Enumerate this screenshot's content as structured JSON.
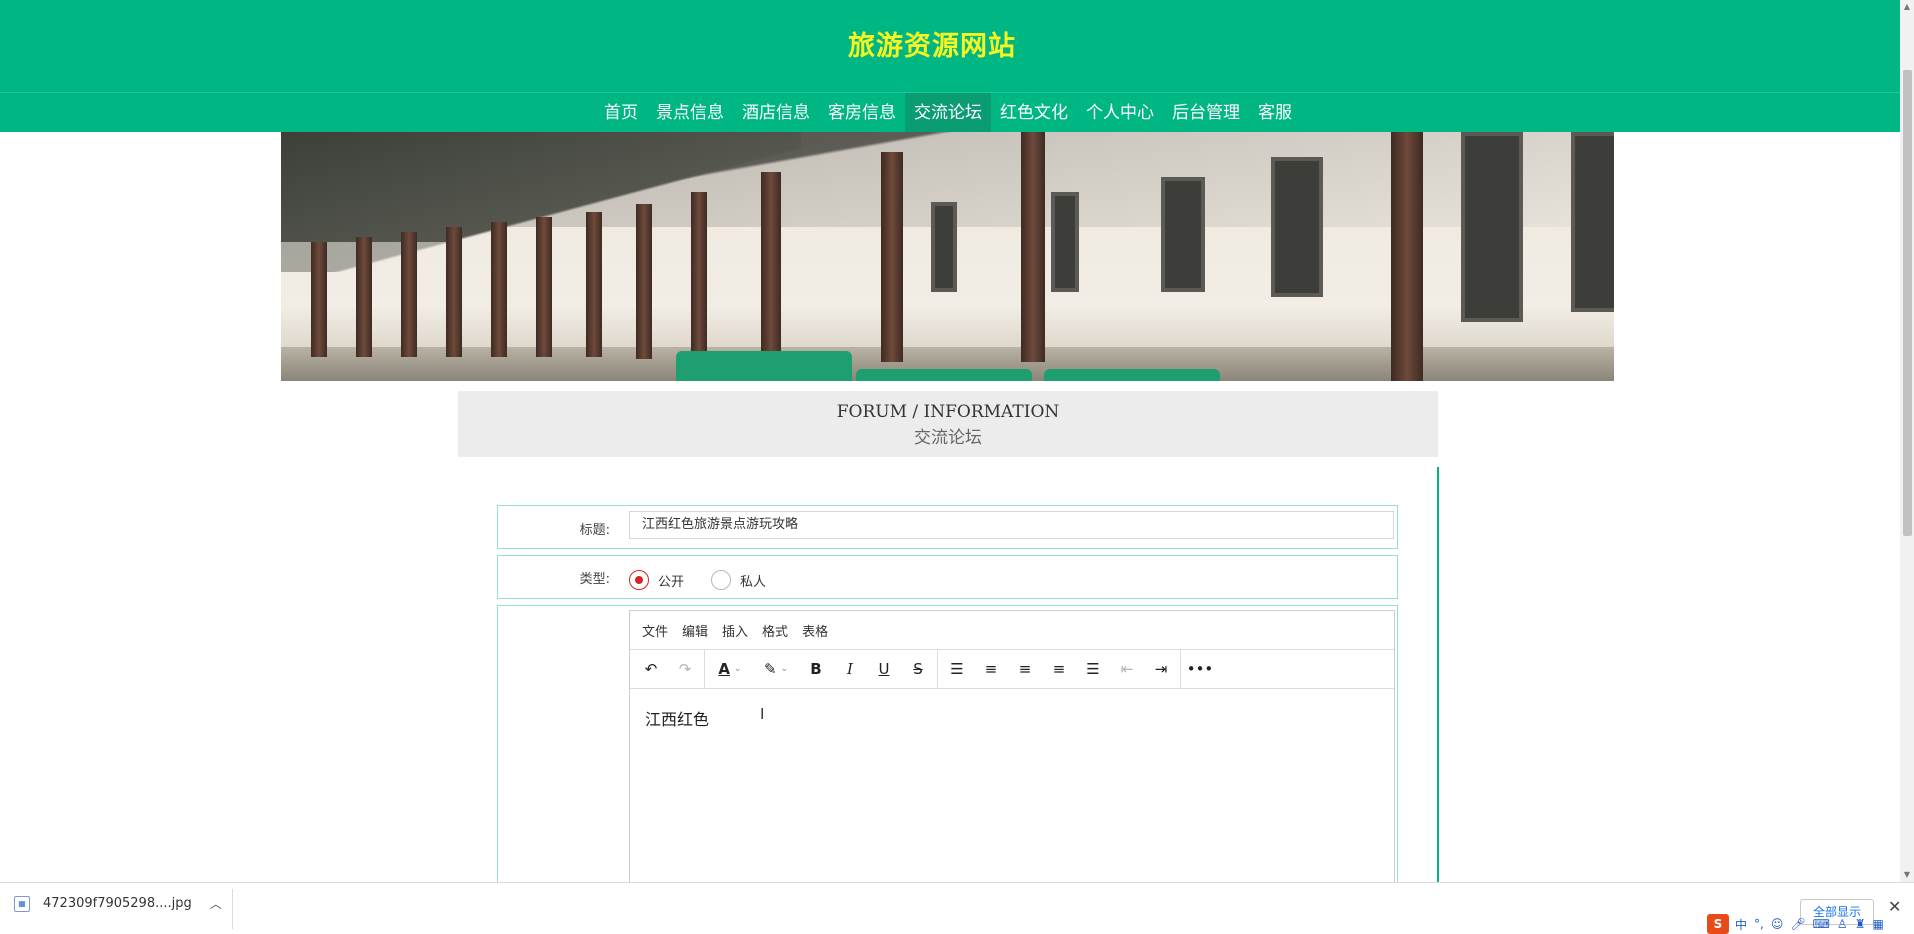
{
  "header": {
    "site_title": "旅游资源网站"
  },
  "nav": {
    "items": [
      {
        "label": "首页",
        "active": false
      },
      {
        "label": "景点信息",
        "active": false
      },
      {
        "label": "酒店信息",
        "active": false
      },
      {
        "label": "客房信息",
        "active": false
      },
      {
        "label": "交流论坛",
        "active": true
      },
      {
        "label": "红色文化",
        "active": false
      },
      {
        "label": "个人中心",
        "active": false
      },
      {
        "label": "后台管理",
        "active": false
      },
      {
        "label": "客服",
        "active": false
      }
    ]
  },
  "forum": {
    "title_en": "FORUM / INFORMATION",
    "title_cn": "交流论坛"
  },
  "form": {
    "title_label": "标题:",
    "title_value": "江西红色旅游景点游玩攻略",
    "type_label": "类型:",
    "type_options": [
      {
        "label": "公开",
        "checked": true
      },
      {
        "label": "私人",
        "checked": false
      }
    ]
  },
  "editor": {
    "menu": [
      "文件",
      "编辑",
      "插入",
      "格式",
      "表格"
    ],
    "content": "江西红色",
    "toolbar_icons": [
      "undo-icon",
      "redo-icon",
      "text-color-icon",
      "highlight-icon",
      "bold-icon",
      "italic-icon",
      "underline-icon",
      "strikethrough-icon",
      "line-height-icon",
      "align-left-icon",
      "align-center-icon",
      "align-right-icon",
      "align-justify-icon",
      "outdent-icon",
      "indent-icon",
      "more-icon"
    ]
  },
  "download_bar": {
    "file_name": "472309f7905298....jpg",
    "show_all": "全部显示"
  },
  "ime": {
    "mode_label": "中"
  },
  "colors": {
    "brand": "#00b683",
    "brand_dark": "#0a9d73",
    "title": "#f5f521",
    "radio_checked": "#d62424"
  }
}
